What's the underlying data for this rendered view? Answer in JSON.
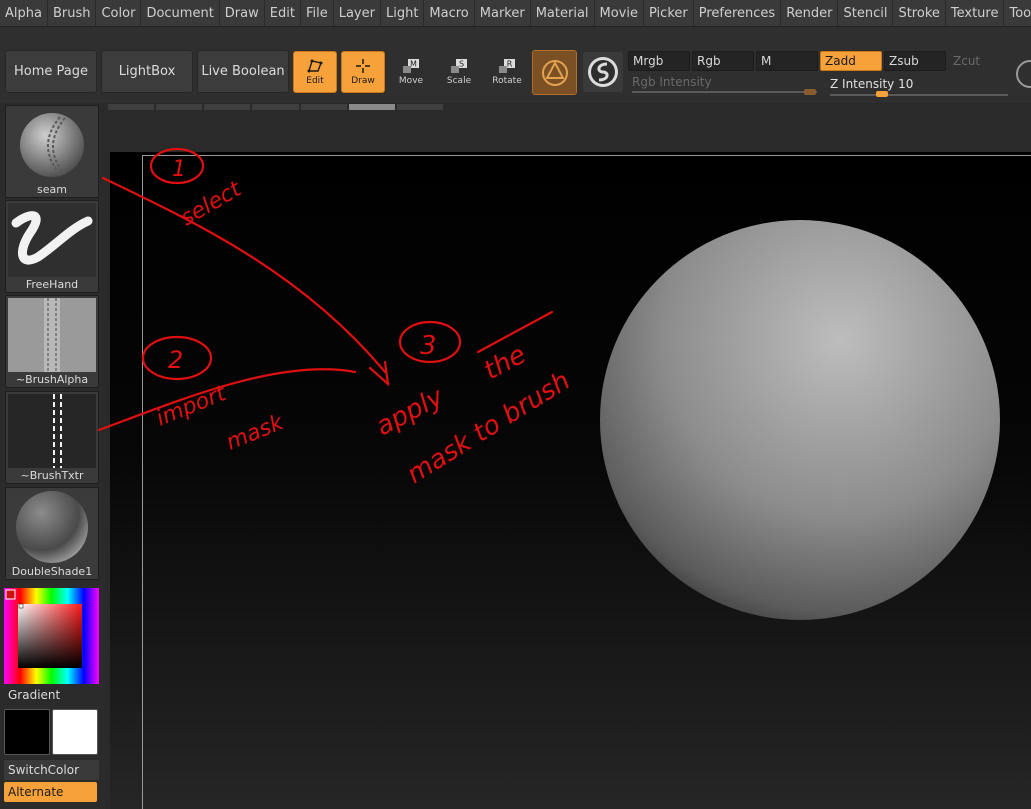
{
  "menubar": {
    "items": [
      "Alpha",
      "Brush",
      "Color",
      "Document",
      "Draw",
      "Edit",
      "File",
      "Layer",
      "Light",
      "Macro",
      "Marker",
      "Material",
      "Movie",
      "Picker",
      "Preferences",
      "Render",
      "Stencil",
      "Stroke",
      "Texture",
      "Tool"
    ]
  },
  "shelf": {
    "home_page": "Home Page",
    "lightbox": "LightBox",
    "live_boolean": "Live Boolean",
    "edit": "Edit",
    "draw": "Draw",
    "move": "Move",
    "scale": "Scale",
    "rotate": "Rotate",
    "move_key": "M",
    "scale_key": "S",
    "rotate_key": "R",
    "mrgb": "Mrgb",
    "rgb": "Rgb",
    "m": "M",
    "zadd": "Zadd",
    "zsub": "Zsub",
    "zcut": "Zcut",
    "rgb_intensity_label": "Rgb Intensity",
    "z_intensity_label": "Z Intensity",
    "z_intensity_value": "10"
  },
  "leftpanel": {
    "brush": "seam",
    "stroke": "FreeHand",
    "alpha": "~BrushAlpha",
    "texture": "~BrushTxtr",
    "material": "DoubleShade1",
    "gradient": "Gradient",
    "switch_color": "SwitchColor",
    "alternate": "Alternate"
  },
  "annotations": {
    "step1_num": "1",
    "step1_text": "select",
    "step2_num": "2",
    "step2_text_a": "import",
    "step2_text_b": "mask",
    "step3_num": "3",
    "step3_text_a": "apply",
    "step3_text_b": "the",
    "step3_text_c": "mask to brush"
  },
  "colors": {
    "accent": "#f7a13a",
    "annotation": "#e01010",
    "primary_color": "#000000",
    "secondary_color": "#ffffff"
  }
}
